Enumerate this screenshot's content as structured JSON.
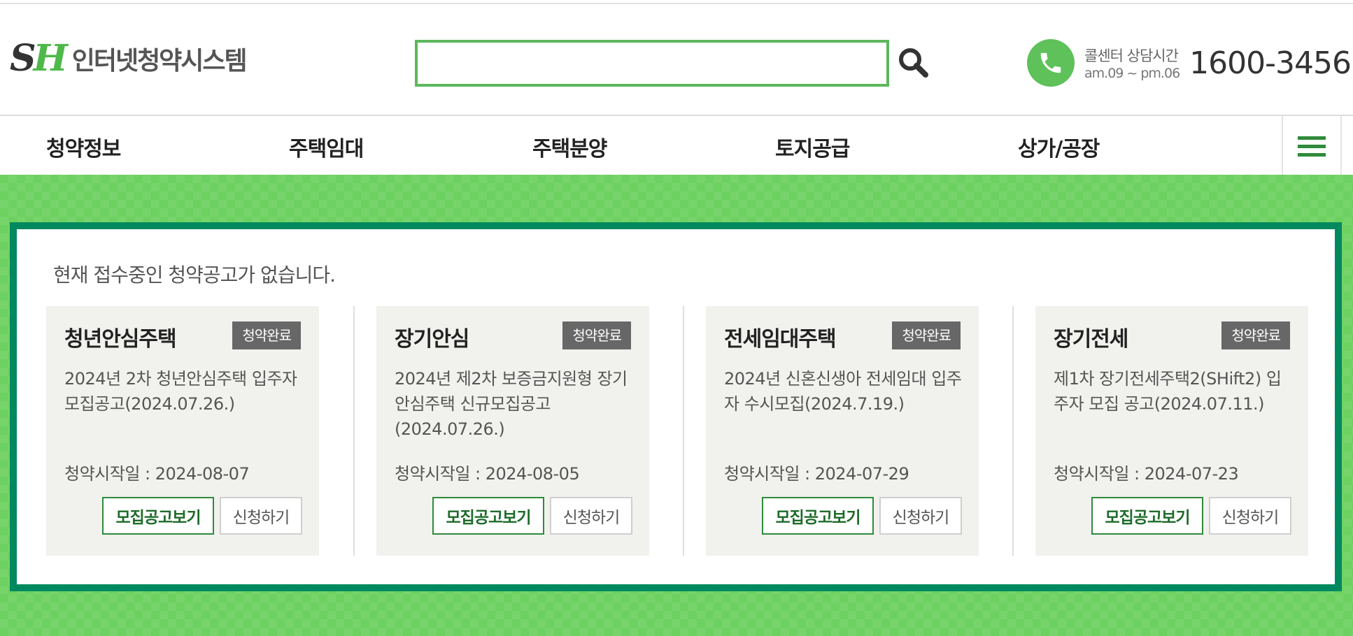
{
  "header": {
    "logo_mark": "SH",
    "logo_text": "인터넷청약시스템",
    "search": {
      "value": "",
      "placeholder": ""
    },
    "callcenter": {
      "label": "콜센터 상담시간",
      "hours": "am.09 ~ pm.06",
      "number": "1600-3456"
    }
  },
  "nav": {
    "items": [
      {
        "label": "청약정보"
      },
      {
        "label": "주택임대"
      },
      {
        "label": "주택분양"
      },
      {
        "label": "토지공급"
      },
      {
        "label": "상가/공장"
      }
    ]
  },
  "main": {
    "notice": "현재 접수중인 청약공고가 없습니다.",
    "cards": [
      {
        "title": "청년안심주택",
        "badge": "청약완료",
        "desc": "2024년 2차 청년안심주택 입주자모집공고(2024.07.26.)",
        "date": "청약시작일 : 2024-08-07",
        "view_label": "모집공고보기",
        "apply_label": "신청하기"
      },
      {
        "title": "장기안심",
        "badge": "청약완료",
        "desc": "2024년 제2차 보증금지원형 장기안심주택 신규모집공고(2024.07.26.)",
        "date": "청약시작일 : 2024-08-05",
        "view_label": "모집공고보기",
        "apply_label": "신청하기"
      },
      {
        "title": "전세임대주택",
        "badge": "청약완료",
        "desc": "2024년 신혼신생아 전세임대 입주자 수시모집(2024.7.19.)",
        "date": "청약시작일 : 2024-07-29",
        "view_label": "모집공고보기",
        "apply_label": "신청하기"
      },
      {
        "title": "장기전세",
        "badge": "청약완료",
        "desc": "제1차 장기전세주택2(SHift2) 입주자 모집 공고(2024.07.11.)",
        "date": "청약시작일 : 2024-07-23",
        "view_label": "모집공고보기",
        "apply_label": "신청하기"
      }
    ]
  },
  "colors": {
    "brand_green": "#5cb85c",
    "panel_border": "#00895f",
    "band_green": "#6cd160",
    "badge_gray": "#676767"
  },
  "icons": {
    "search": "search-icon",
    "phone": "phone-icon",
    "menu": "hamburger-menu-icon"
  }
}
